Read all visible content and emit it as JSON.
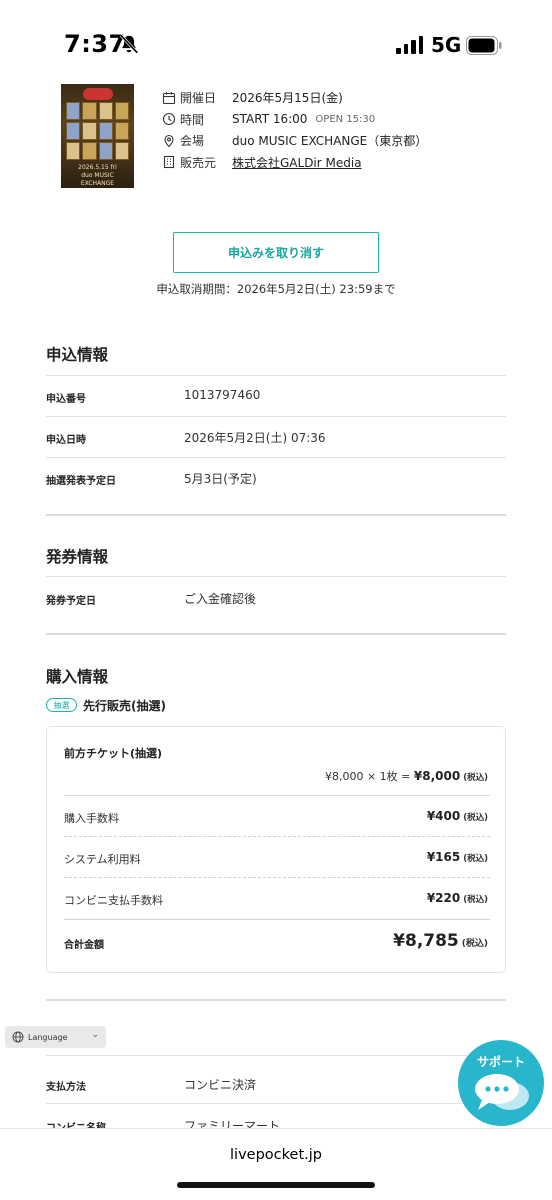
{
  "status_bar": {
    "time": "7:37",
    "network": "5G"
  },
  "event": {
    "poster_text": "2026.5.15 fri\nduo MUSIC EXCHANGE",
    "rows": [
      {
        "icon": "calendar-icon",
        "label": "開催日",
        "value": "2026年5月15日(金)"
      },
      {
        "icon": "clock-icon",
        "label": "時間",
        "value": "START 16:00",
        "extra": "OPEN 15:30"
      },
      {
        "icon": "location-icon",
        "label": "会場",
        "value": "duo MUSIC EXCHANGE（東京都）"
      },
      {
        "icon": "building-icon",
        "label": "販売元",
        "value": "株式会社GALDir Media"
      }
    ]
  },
  "cancel": {
    "button_label": "申込みを取り消す",
    "period": "申込取消期間：2026年5月2日(土) 23:59まで"
  },
  "application": {
    "title": "申込情報",
    "rows": [
      {
        "label": "申込番号",
        "value": "1013797460"
      },
      {
        "label": "申込日時",
        "value": "2026年5月2日(土) 07:36"
      },
      {
        "label": "抽選発表予定日",
        "value": "5月3日(予定)"
      }
    ]
  },
  "ticketing": {
    "title": "発券情報",
    "rows": [
      {
        "label": "発券予定日",
        "value": "ご入金確認後"
      }
    ]
  },
  "purchase": {
    "title": "購入情報",
    "badge": "抽選",
    "sale_type": "先行販売(抽選)",
    "ticket_name": "前方チケット(抽選)",
    "calc_prefix": "¥8,000 × 1枚 = ",
    "calc_total": "¥8,000",
    "tax_label": "(税込)",
    "fees": [
      {
        "label": "購入手数料",
        "value": "¥400"
      },
      {
        "label": "システム利用料",
        "value": "¥165"
      },
      {
        "label": "コンビニ支払手数料",
        "value": "¥220"
      }
    ],
    "total_label": "合計金額",
    "total_value": "¥8,785"
  },
  "payment": {
    "rows": [
      {
        "label": "支払方法",
        "value": "コンビニ決済"
      },
      {
        "label": "コンビニ名称",
        "value": "ファミリーマート"
      }
    ]
  },
  "language": {
    "label": "Language"
  },
  "support": {
    "label": "サポート"
  },
  "browser": {
    "url": "livepocket.jp"
  }
}
